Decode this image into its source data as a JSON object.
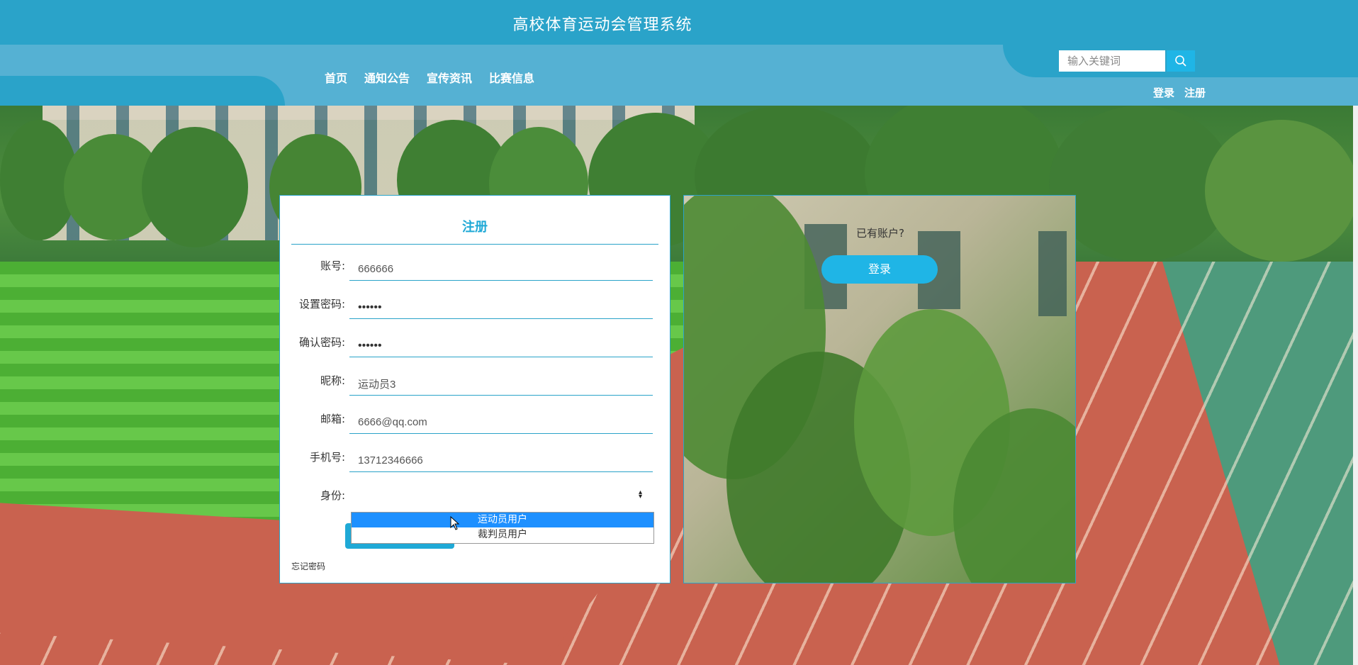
{
  "header": {
    "site_title": "高校体育运动会管理系统",
    "nav": [
      "首页",
      "通知公告",
      "宣传资讯",
      "比赛信息"
    ],
    "search_placeholder": "输入关键词",
    "login_link": "登录",
    "register_link": "注册"
  },
  "register_form": {
    "title": "注册",
    "fields": [
      {
        "label": "账号:",
        "value": "666666"
      },
      {
        "label": "设置密码:",
        "value": "••••••"
      },
      {
        "label": "确认密码:",
        "value": "••••••"
      },
      {
        "label": "昵称:",
        "value": "运动员3"
      },
      {
        "label": "邮箱:",
        "value": "6666@qq.com"
      },
      {
        "label": "手机号:",
        "value": "13712346666"
      }
    ],
    "role_label": "身份:",
    "role_options": [
      "运动员用户",
      "裁判员用户"
    ],
    "role_highlighted": "运动员用户",
    "forgot_password": "忘记密码"
  },
  "side_panel": {
    "have_account": "已有账户?",
    "login_button": "登录"
  },
  "colors": {
    "primary": "#2aa3c9",
    "nav_bar": "#55b1d3",
    "button": "#1fb5e6",
    "dropdown_highlight": "#1e90ff"
  }
}
